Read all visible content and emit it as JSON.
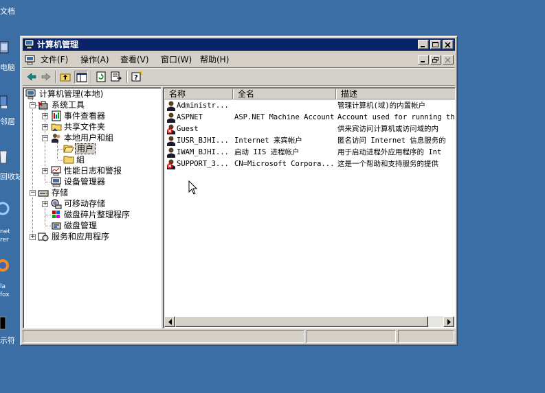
{
  "desktop": {
    "labels": [
      "文档",
      "电脑",
      "邻居",
      "回收站",
      "net\nrer",
      "la\nfox",
      "示符"
    ]
  },
  "window": {
    "title": "计算机管理",
    "menu": [
      "文件(F)",
      "操作(A)",
      "查看(V)",
      "窗口(W)",
      "帮助(H)"
    ],
    "toolbar_icons": [
      "back-arrow-icon",
      "forward-arrow-icon",
      "up-folder-icon",
      "show-hide-tree-icon",
      "refresh-icon",
      "export-list-icon",
      "help-icon"
    ]
  },
  "tree": {
    "root": "计算机管理(本地)",
    "system_tools": "系统工具",
    "event_viewer": "事件查看器",
    "shared_folders": "共享文件夹",
    "local_users_groups": "本地用户和組",
    "users": "用户",
    "groups": "組",
    "perf_logs": "性能日志和警报",
    "device_manager": "设备管理器",
    "storage": "存储",
    "removable_storage": "可移动存储",
    "disk_defrag": "磁盘碎片整理程序",
    "disk_management": "磁盘管理",
    "services_apps": "服务和应用程序"
  },
  "list": {
    "columns": [
      "名称",
      "全名",
      "描述"
    ],
    "rows": [
      {
        "name": "Administr...",
        "fullname": "",
        "description": "管理计算机(域)的内置帐户",
        "disabled": false
      },
      {
        "name": "ASPNET",
        "fullname": "ASP.NET Machine Account",
        "description": "Account used for running the",
        "disabled": false
      },
      {
        "name": "Guest",
        "fullname": "",
        "description": "供来宾访问计算机或访问域的内",
        "disabled": true
      },
      {
        "name": "IUSR_BJHI...",
        "fullname": "Internet 来宾帐户",
        "description": "匿名访问 Internet 信息服务的",
        "disabled": false
      },
      {
        "name": "IWAM_BJHI...",
        "fullname": "启动 IIS 进程帐户",
        "description": "用于启动进程外应用程序的 Int",
        "disabled": false
      },
      {
        "name": "SUPPORT_3...",
        "fullname": "CN=Microsoft Corpora...",
        "description": "这是一个帮助和支持服务的提供",
        "disabled": true
      }
    ]
  },
  "statusbar": [
    "",
    "",
    ""
  ],
  "colors": {
    "desktop": "#3a6ea5",
    "title_bar": "#0a246a",
    "face": "#d4d0c8"
  }
}
